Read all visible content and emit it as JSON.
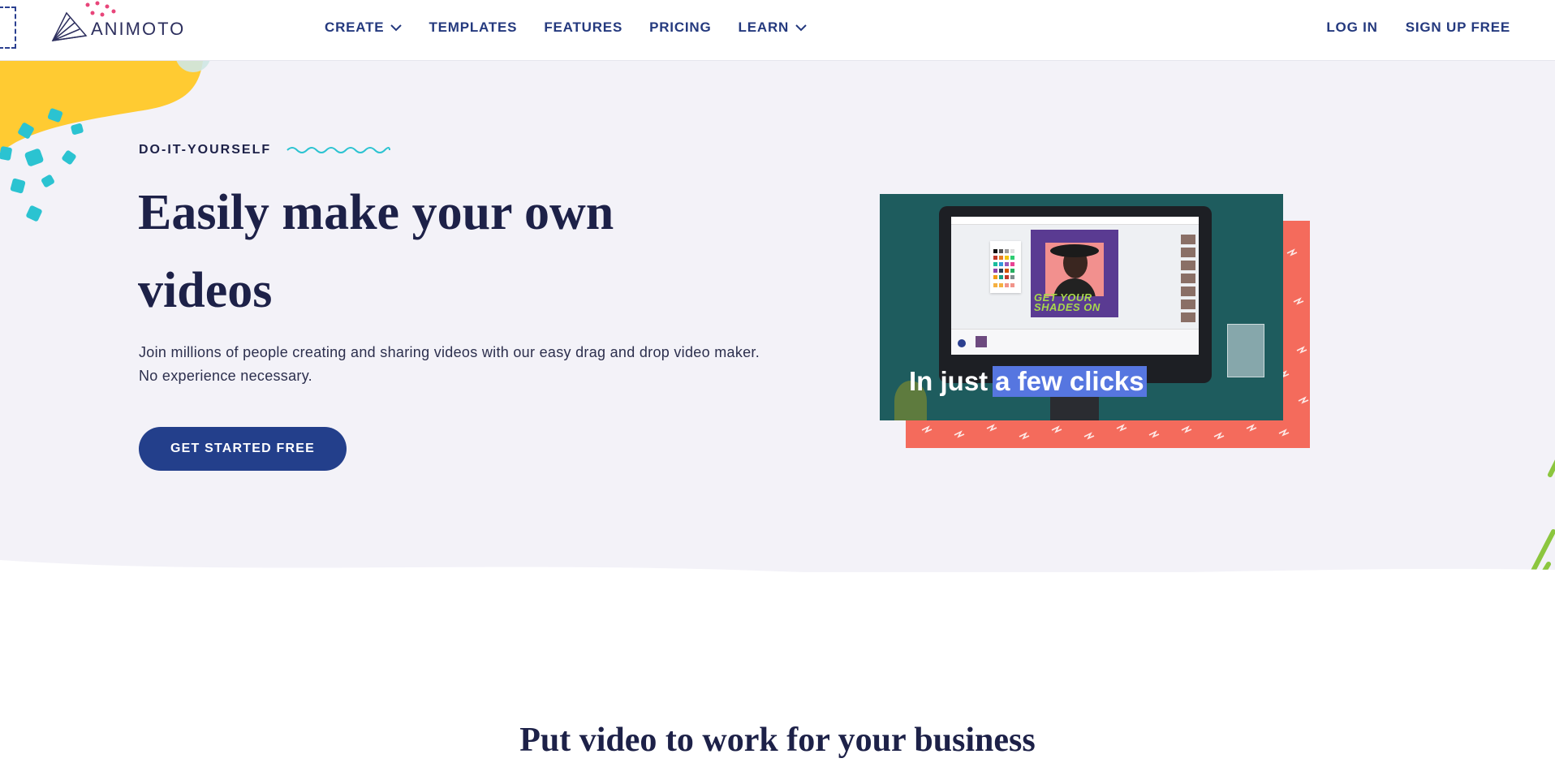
{
  "brand": {
    "name": "ANIMOTO"
  },
  "nav": {
    "create": "CREATE",
    "templates": "TEMPLATES",
    "features": "FEATURES",
    "pricing": "PRICING",
    "learn": "LEARN",
    "login": "LOG IN",
    "signup": "SIGN UP FREE"
  },
  "hero": {
    "eyebrow": "DO-IT-YOURSELF",
    "headline": "Easily make your own videos",
    "subtext": "Join millions of people creating and sharing videos with our easy drag and drop video maker. No experience necessary.",
    "cta": "GET STARTED FREE"
  },
  "video": {
    "poster_text": "GET YOUR SHADES ON",
    "caption_plain": "In just",
    "caption_highlight": "a few clicks"
  },
  "section": {
    "title": "Put video to work for your business"
  },
  "colors": {
    "primary": "#233f8b",
    "nav_text": "#24397e",
    "hero_bg": "#f3f2f8",
    "coral": "#f46b5c",
    "accent_teal": "#2bc3d1",
    "accent_yellow": "#ffcb32",
    "accent_green": "#8cc63f",
    "highlight": "#5676e0"
  },
  "icons": [
    "animoto-logo-icon",
    "chevron-down-icon",
    "wavy-line-icon"
  ]
}
